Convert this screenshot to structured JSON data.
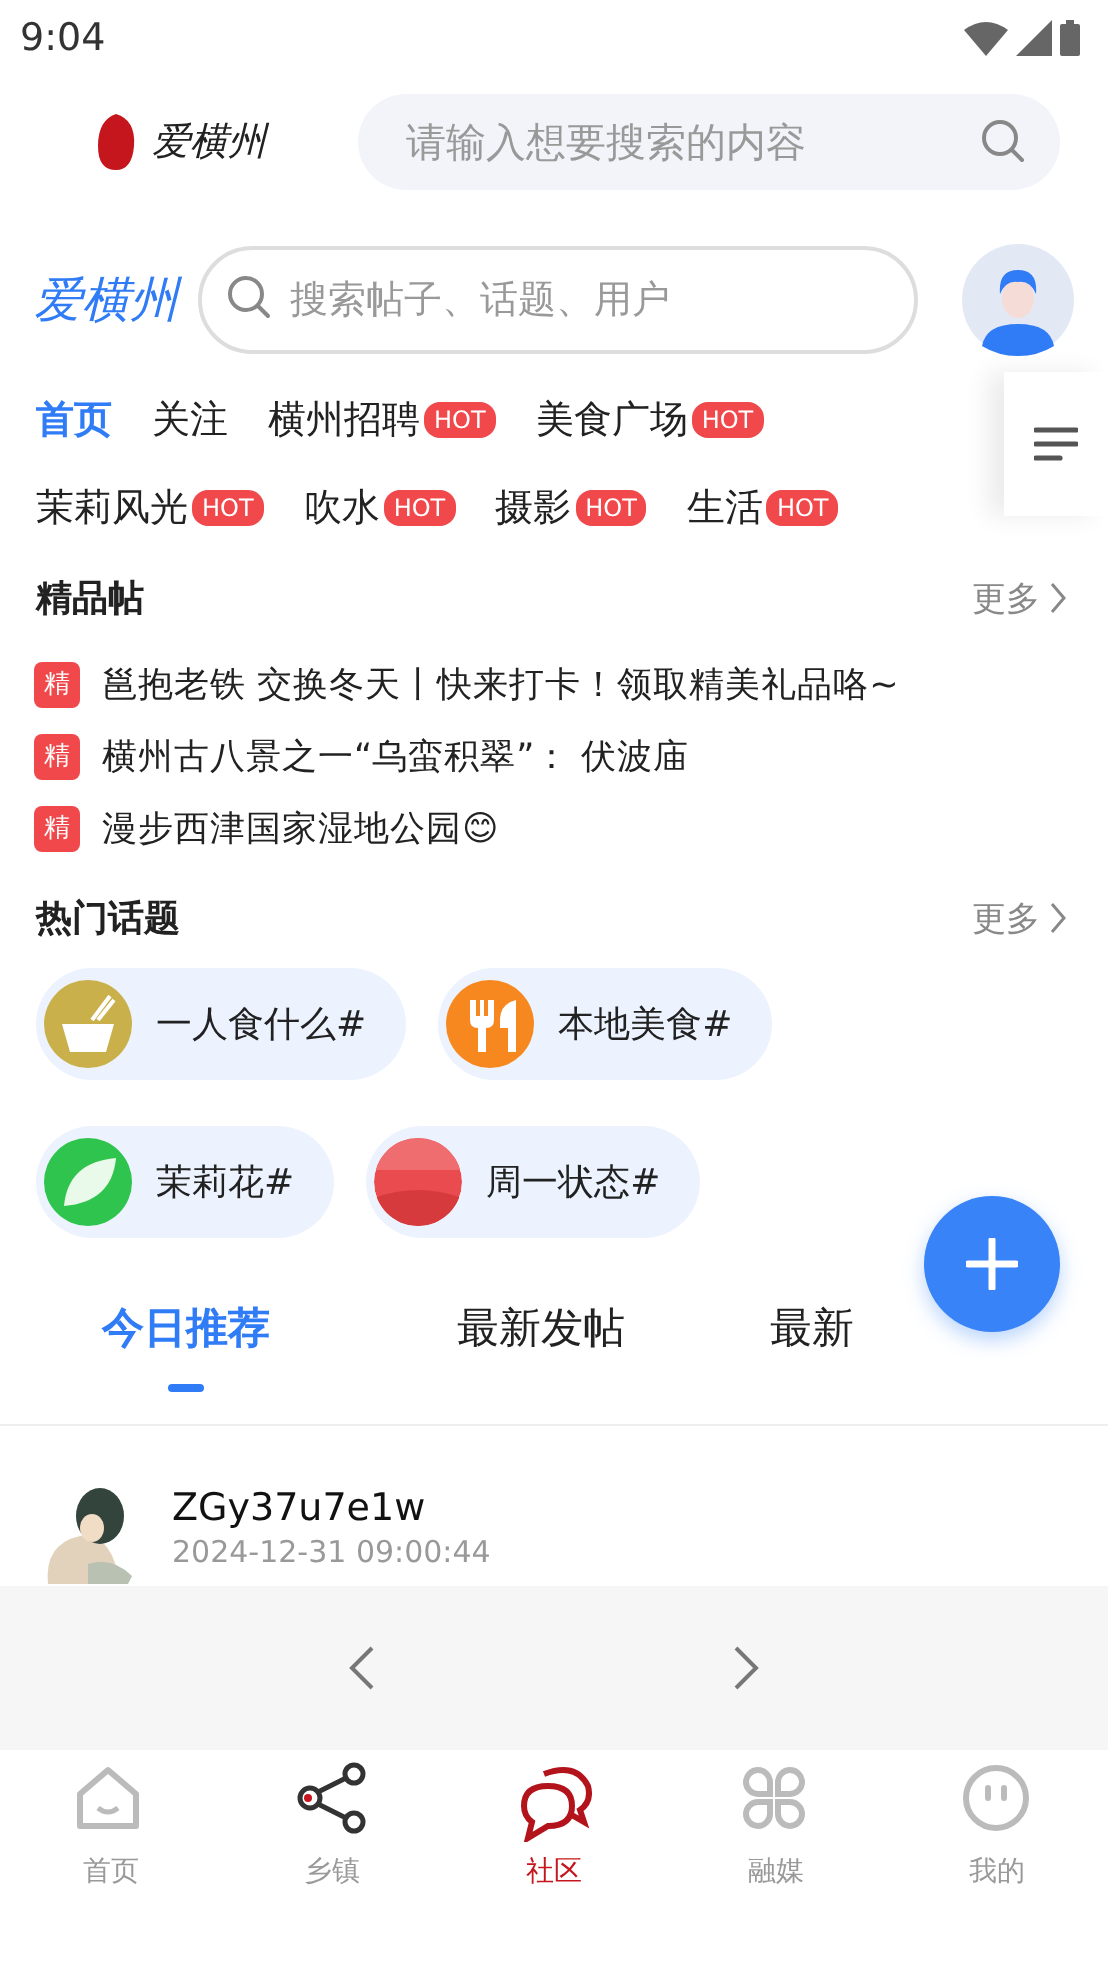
{
  "status_bar": {
    "time": "9:04"
  },
  "header": {
    "logo": "爱横州",
    "search": {
      "placeholder": "请输入想要搜索的内容"
    }
  },
  "community_bar": {
    "title": "爱横州",
    "search": {
      "placeholder": "搜索帖子、话题、用户"
    }
  },
  "categories": [
    {
      "label": "首页",
      "selected": true
    },
    {
      "label": "关注",
      "selected": false
    },
    {
      "label": "横州招聘",
      "selected": false,
      "badge": "HOT"
    },
    {
      "label": "美食广场",
      "selected": false,
      "badge": "HOT"
    },
    {
      "label": "茉莉风光",
      "selected": false,
      "badge": "HOT"
    },
    {
      "label": "吹水",
      "selected": false,
      "badge": "HOT"
    },
    {
      "label": "摄影",
      "selected": false,
      "badge": "HOT"
    },
    {
      "label": "生活",
      "selected": false,
      "badge": "HOT"
    }
  ],
  "featured": {
    "title": "精品帖",
    "more": "更多",
    "posts": [
      {
        "tag": "精",
        "text": "邕抱老铁 交换冬天丨快来打卡！领取精美礼品咯~"
      },
      {
        "tag": "精",
        "text": "横州古八景之一“乌蛮积翠”： 伏波庙"
      },
      {
        "tag": "精",
        "text": "漫步西津国家湿地公园😊"
      }
    ]
  },
  "topics": {
    "title": "热门话题",
    "more": "更多",
    "items": [
      {
        "label": "一人食什么#",
        "kind": "bowl",
        "color": "#c9b04a"
      },
      {
        "label": "本地美食#",
        "kind": "cutlery",
        "color": "#f7881f"
      },
      {
        "label": "茉莉花#",
        "kind": "leaf",
        "color": "#2ec44d"
      },
      {
        "label": "周一状态#",
        "kind": "picture",
        "color": "#e94b4e"
      }
    ]
  },
  "feed_tabs": [
    {
      "label": "今日推荐",
      "selected": true
    },
    {
      "label": "最新发帖",
      "selected": false
    },
    {
      "label": "最新",
      "selected": false
    }
  ],
  "posts": [
    {
      "user": "ZGy37u7e1w",
      "time": "2024-12-31 09:00:44"
    }
  ],
  "bottom_nav": [
    {
      "label": "首页",
      "kind": "home",
      "selected": false
    },
    {
      "label": "乡镇",
      "kind": "share",
      "selected": false
    },
    {
      "label": "社区",
      "kind": "chat",
      "selected": true
    },
    {
      "label": "融媒",
      "kind": "grid",
      "selected": false
    },
    {
      "label": "我的",
      "kind": "face",
      "selected": false
    }
  ]
}
